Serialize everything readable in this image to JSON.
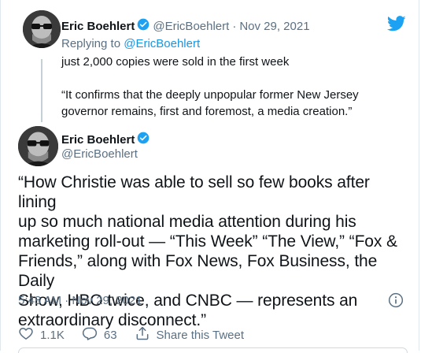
{
  "parent_tweet": {
    "name": "Eric Boehlert",
    "handle": "@EricBoehlert",
    "separator": "·",
    "date": "Nov 29, 2021",
    "replying_prefix": "Replying to",
    "replying_handle": "@EricBoehlert",
    "text_line1": "just 2,000 copies were sold in the first week",
    "text_quote_line1": "“It confirms that the deeply unpopular former New Jersey",
    "text_quote_line2": "governor remains, first and foremost, a media creation.”"
  },
  "main_tweet": {
    "name": "Eric Boehlert",
    "handle": "@EricBoehlert",
    "text_lines": [
      "“How Christie was able to sell so few books after lining",
      "up so much national media attention during his",
      "marketing roll-out — “This Week” “The View,” “Fox &",
      "Friends,” along with Fox News, Fox Business, the Daily",
      "Show, HBO twice, and CNBC — represents an",
      "extraordinary disconnect.”"
    ],
    "timestamp": "5:48 AM · Nov 29, 2021"
  },
  "actions": {
    "like_count": "1.1K",
    "reply_count": "63",
    "share_label": "Share this Tweet"
  },
  "icons": {
    "brand": "twitter-bird-icon",
    "verified": "verified-badge-icon",
    "info": "info-icon",
    "like": "heart-icon",
    "reply": "reply-bubble-icon",
    "share": "share-icon"
  },
  "colors": {
    "brand_blue": "#1da1f2",
    "link_blue": "#1b95e0",
    "muted_text": "#5b7083",
    "thread_line": "#c4cfd6"
  }
}
